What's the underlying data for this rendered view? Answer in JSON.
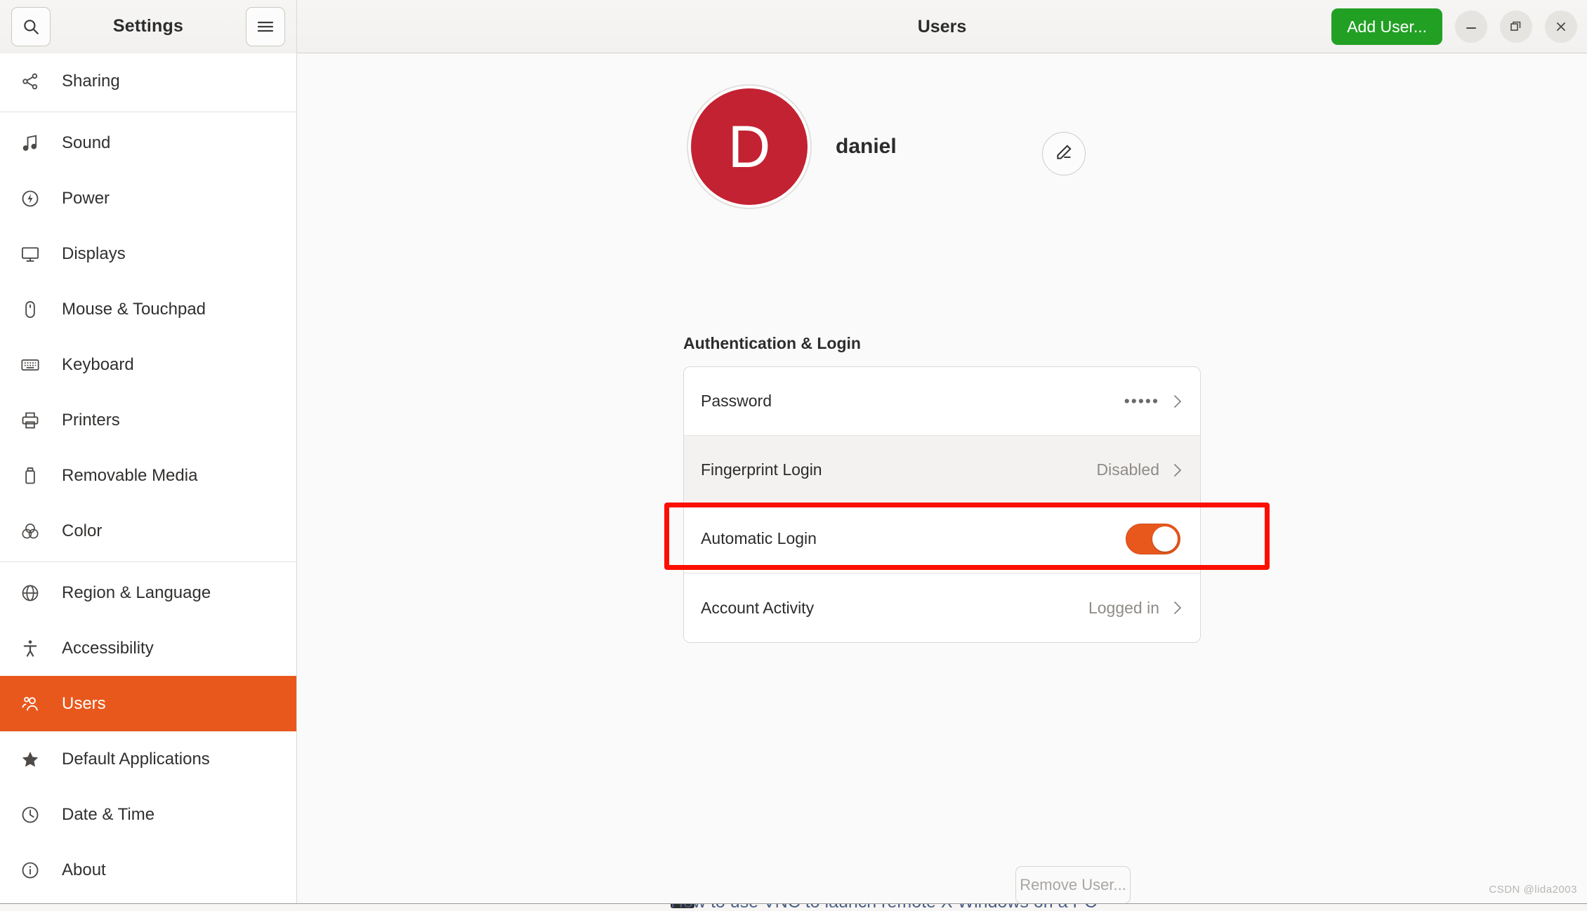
{
  "window": {
    "app_title": "Settings",
    "page_title": "Users",
    "controls": {
      "minimize": "minimize-icon",
      "maximize": "restore-icon",
      "close": "close-icon"
    }
  },
  "header": {
    "search_icon": "search-icon",
    "menu_icon": "hamburger-menu-icon",
    "add_user_label": "Add User..."
  },
  "sidebar": {
    "items": [
      {
        "label": "Sharing",
        "icon": "share-icon",
        "active": false,
        "sep_after": true
      },
      {
        "label": "Sound",
        "icon": "sound-icon",
        "active": false,
        "sep_after": false
      },
      {
        "label": "Power",
        "icon": "power-icon",
        "active": false,
        "sep_after": false
      },
      {
        "label": "Displays",
        "icon": "display-icon",
        "active": false,
        "sep_after": false
      },
      {
        "label": "Mouse & Touchpad",
        "icon": "mouse-icon",
        "active": false,
        "sep_after": false
      },
      {
        "label": "Keyboard",
        "icon": "keyboard-icon",
        "active": false,
        "sep_after": false
      },
      {
        "label": "Printers",
        "icon": "printer-icon",
        "active": false,
        "sep_after": false
      },
      {
        "label": "Removable Media",
        "icon": "usb-drive-icon",
        "active": false,
        "sep_after": false
      },
      {
        "label": "Color",
        "icon": "color-icon",
        "active": false,
        "sep_after": true
      },
      {
        "label": "Region & Language",
        "icon": "globe-icon",
        "active": false,
        "sep_after": false
      },
      {
        "label": "Accessibility",
        "icon": "accessibility-icon",
        "active": false,
        "sep_after": false
      },
      {
        "label": "Users",
        "icon": "users-icon",
        "active": true,
        "sep_after": false
      },
      {
        "label": "Default Applications",
        "icon": "star-icon",
        "active": false,
        "sep_after": false
      },
      {
        "label": "Date & Time",
        "icon": "clock-icon",
        "active": false,
        "sep_after": false
      },
      {
        "label": "About",
        "icon": "info-icon",
        "active": false,
        "sep_after": false
      }
    ]
  },
  "main": {
    "user": {
      "avatar_initial": "D",
      "name": "daniel",
      "edit_icon": "pencil-edit-icon"
    },
    "section_title": "Authentication & Login",
    "rows": [
      {
        "label": "Password",
        "value": "•••••",
        "kind": "dots",
        "chevron": true,
        "hover": false
      },
      {
        "label": "Fingerprint Login",
        "value": "Disabled",
        "kind": "text",
        "chevron": true,
        "hover": true
      },
      {
        "label": "Automatic Login",
        "value": "on",
        "kind": "toggle",
        "chevron": false,
        "hover": false
      },
      {
        "label": "Account Activity",
        "value": "Logged in",
        "kind": "text",
        "chevron": true,
        "hover": false
      }
    ],
    "remove_user_label": "Remove User..."
  },
  "colors": {
    "accent_orange": "#e8581c",
    "add_user_green": "#22a024",
    "avatar_red": "#c32232",
    "highlight_red": "#fb0f01",
    "sidebar_bg": "#ffffff",
    "content_bg": "#fafafa"
  },
  "watermark": "CSDN @lida2003",
  "background_window": {
    "partial_text": "How to use VNC to launch remote X Windows on a PC"
  }
}
